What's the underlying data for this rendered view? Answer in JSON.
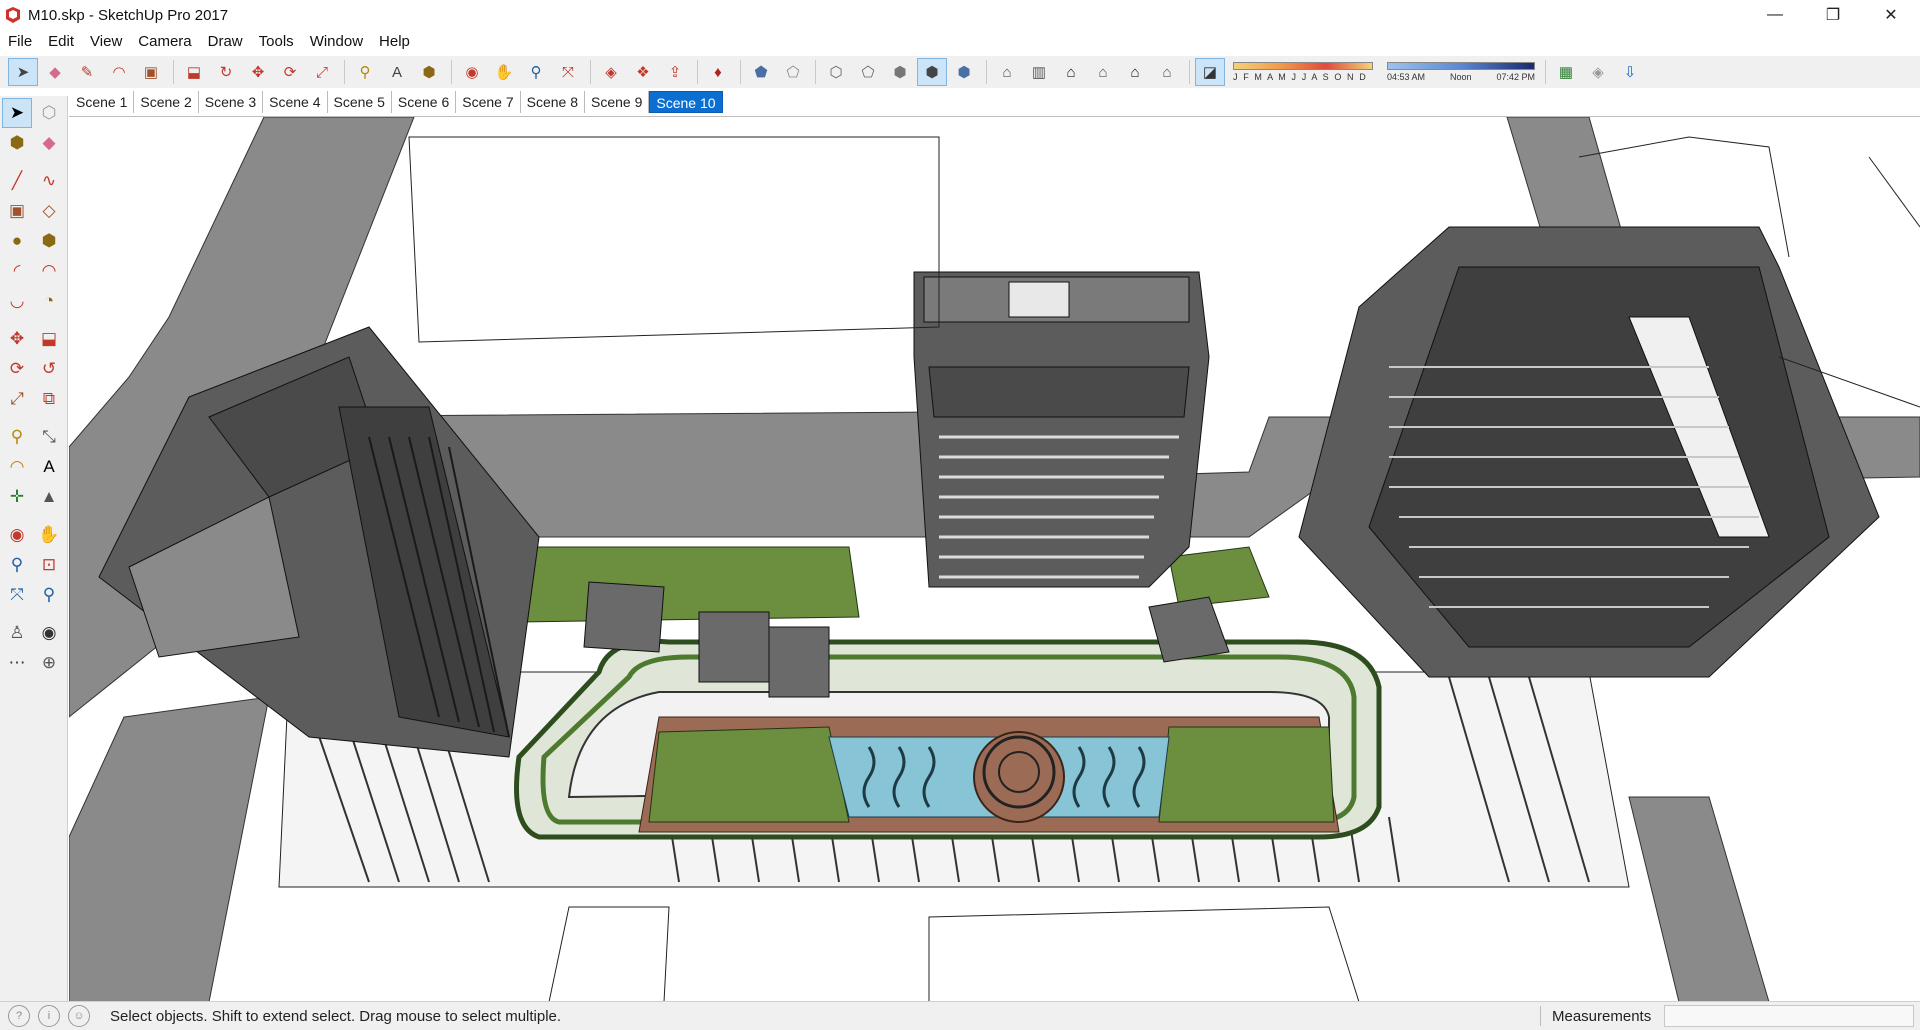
{
  "window": {
    "title": "M10.skp - SketchUp Pro 2017",
    "minimize": "—",
    "restore": "❐",
    "close": "✕"
  },
  "menu": [
    "File",
    "Edit",
    "View",
    "Camera",
    "Draw",
    "Tools",
    "Window",
    "Help"
  ],
  "toolbar": {
    "months": "J F M A M J J A S O N D",
    "time_start": "04:53 AM",
    "time_mid": "Noon",
    "time_end": "07:42 PM"
  },
  "scenes": [
    "Scene 1",
    "Scene 2",
    "Scene 3",
    "Scene 4",
    "Scene 5",
    "Scene 6",
    "Scene 7",
    "Scene 8",
    "Scene 9",
    "Scene 10"
  ],
  "active_scene": "Scene 10",
  "status": {
    "hint": "Select objects. Shift to extend select. Drag mouse to select multiple.",
    "measurements_label": "Measurements",
    "measurements_value": ""
  },
  "colors": {
    "accent": "#0a6fd1",
    "building": "#5c5c5c",
    "road": "#8a8a8a",
    "lawn": "#6b8f3e",
    "water": "#86c4d6",
    "deck": "#9c6b55"
  }
}
